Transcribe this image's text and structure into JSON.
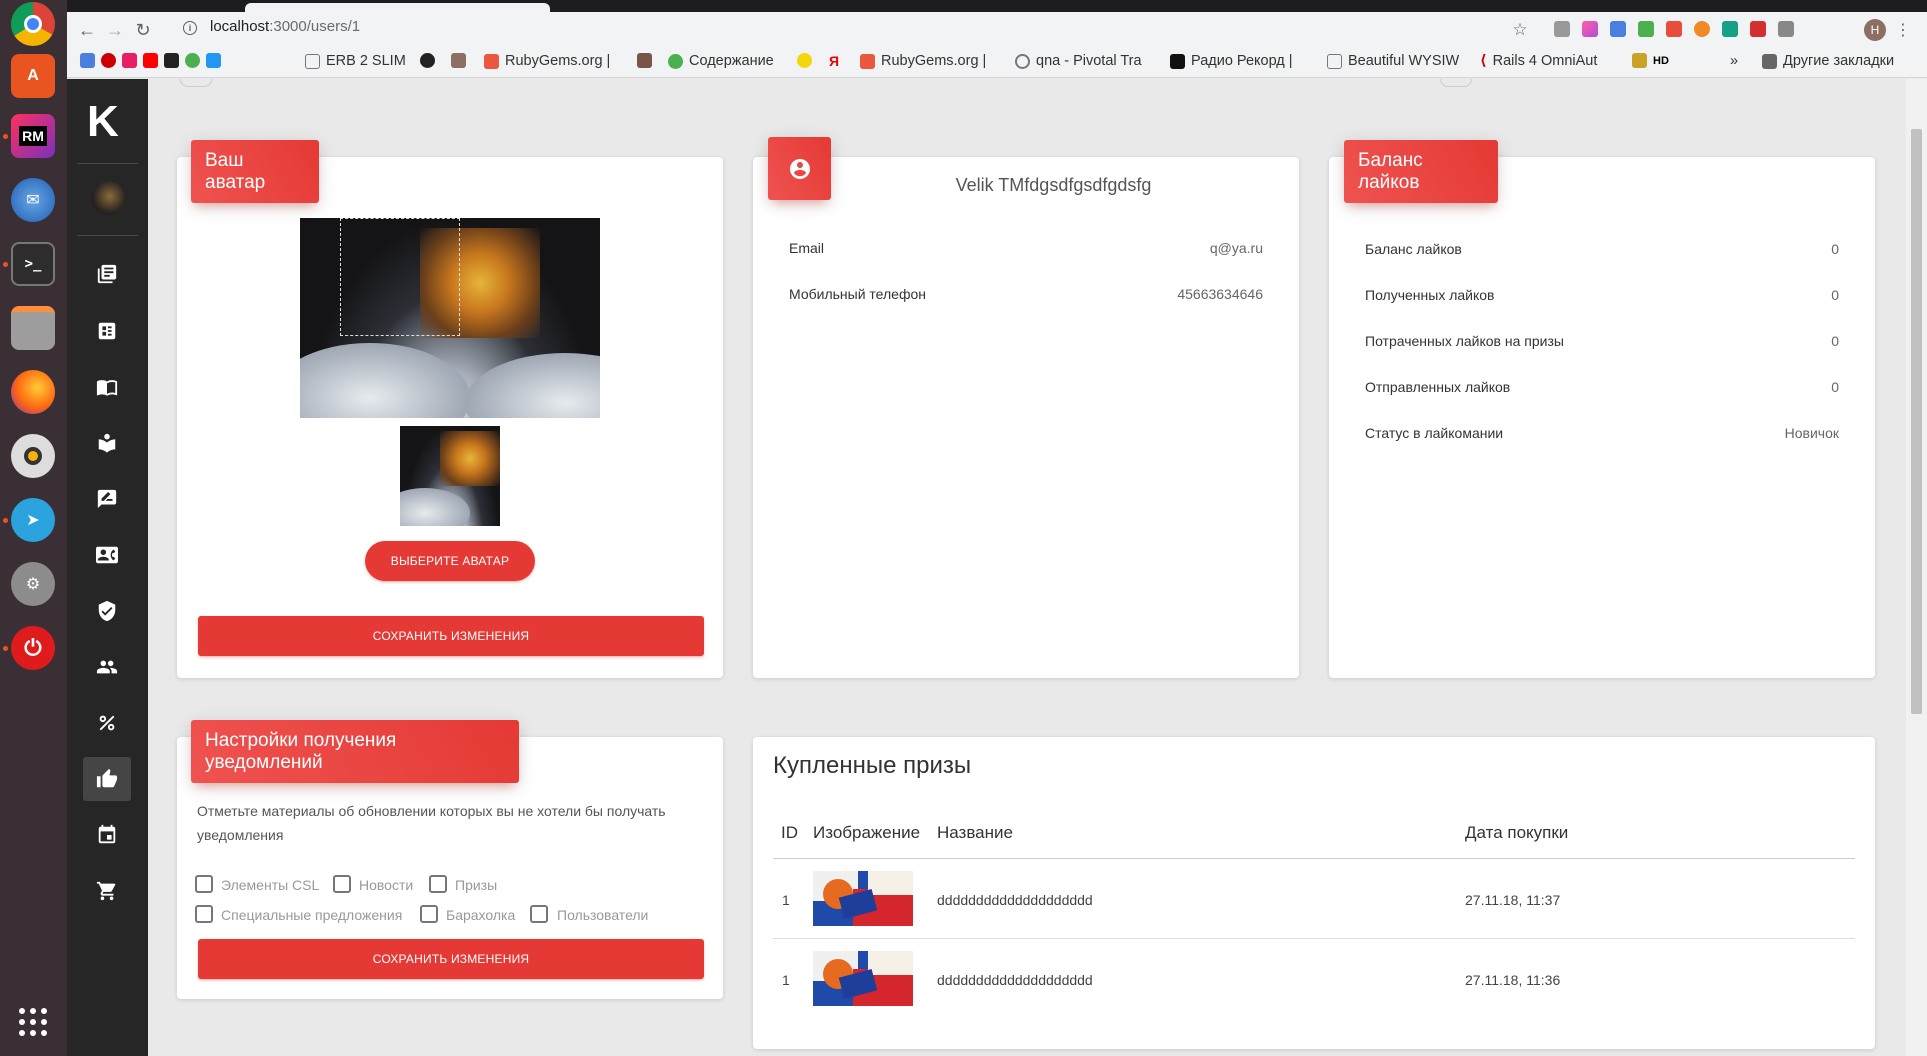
{
  "browser": {
    "url_host": "localhost",
    "url_path": ":3000/users/1",
    "profile_initial": "H",
    "bookmarks": [
      {
        "label": "ERB 2 SLIM",
        "color": "#777"
      },
      {
        "label": "RubyGems.org |",
        "color": "#e9573f"
      },
      {
        "label": "Содержание",
        "color": "#4caf50"
      },
      {
        "label": "RubyGems.org |",
        "color": "#e9573f"
      },
      {
        "label": "qna - Pivotal Tra",
        "color": "#777"
      },
      {
        "label": "Радио Рекорд |",
        "color": "#111"
      },
      {
        "label": "Beautiful WYSIW",
        "color": "#777"
      },
      {
        "label": "Rails 4 OmniAut",
        "color": "#cc0000"
      },
      {
        "label": "HD",
        "color": "#000"
      }
    ],
    "more_bookmarks": "»",
    "other_bookmarks": "Другие закладки"
  },
  "app": {
    "logo": "K"
  },
  "avatar_card": {
    "header": "Ваш аватар",
    "choose_button": "ВЫБЕРИТЕ АВАТАР",
    "save_button": "СОХРАНИТЬ ИЗМЕНЕНИЯ"
  },
  "profile_card": {
    "name": "Velik TMfdgsdfgsdfgdsfg",
    "rows": [
      {
        "label": "Email",
        "value": "q@ya.ru"
      },
      {
        "label": "Мобильный телефон",
        "value": "45663634646"
      }
    ]
  },
  "likes_card": {
    "header": "Баланс лайков",
    "rows": [
      {
        "label": "Баланс лайков",
        "value": "0"
      },
      {
        "label": "Полученных лайков",
        "value": "0"
      },
      {
        "label": "Потраченных лайков на призы",
        "value": "0"
      },
      {
        "label": "Отправленных лайков",
        "value": "0"
      },
      {
        "label": "Статус в лайкомании",
        "value": "Новичок"
      }
    ]
  },
  "notifications_card": {
    "header": "Настройки получения уведомлений",
    "description": "Отметьте материалы об обновлении которых вы не хотели бы получать уведомления",
    "options": [
      "Элементы CSL",
      "Новости",
      "Призы",
      "Специальные предложения",
      "Барахолка",
      "Пользователи"
    ],
    "save_button": "СОХРАНИТЬ ИЗМЕНЕНИЯ"
  },
  "prizes_card": {
    "title": "Купленные призы",
    "columns": [
      "ID",
      "Изображение",
      "Название",
      "Дата покупки"
    ],
    "rows": [
      {
        "id": "1",
        "name": "dddddddddddddddddddd",
        "date": "27.11.18, 11:37"
      },
      {
        "id": "1",
        "name": "dddddddddddddddddddd",
        "date": "27.11.18, 11:36"
      }
    ]
  }
}
